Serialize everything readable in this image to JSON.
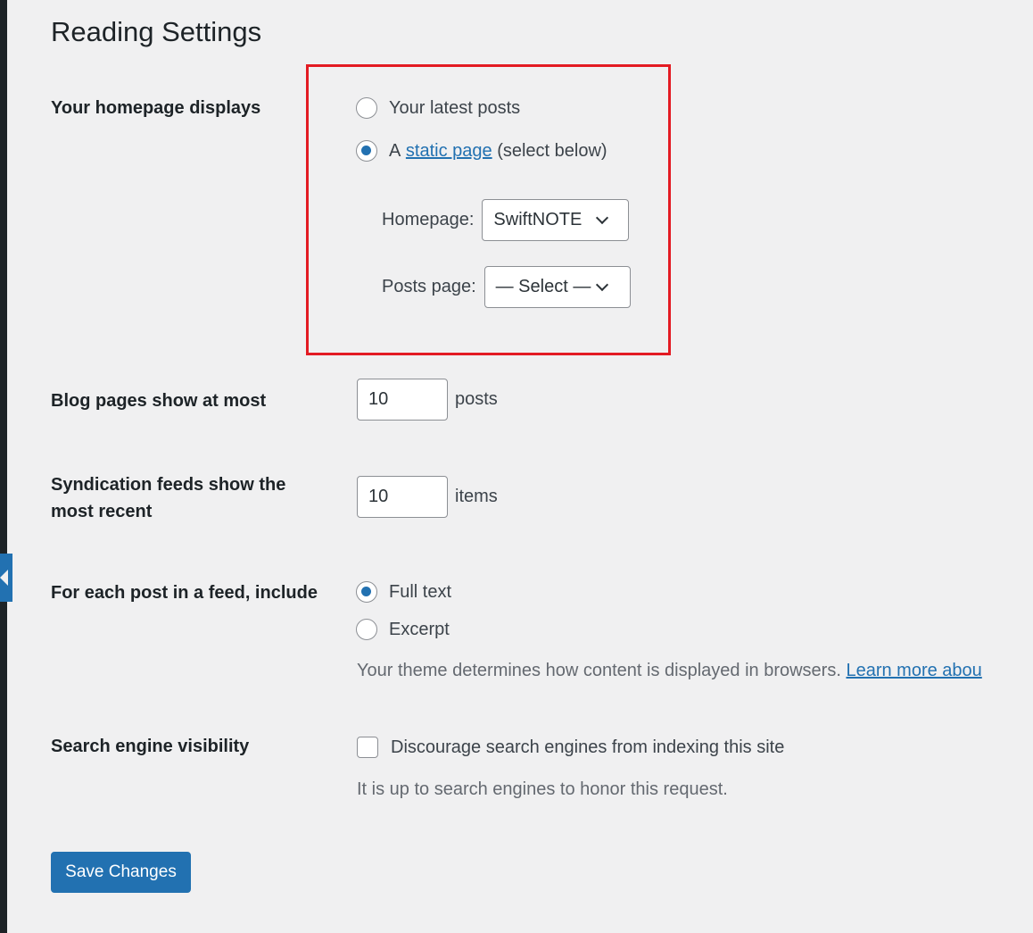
{
  "page": {
    "title": "Reading Settings"
  },
  "homepage_displays": {
    "label": "Your homepage displays",
    "option_latest": "Your latest posts",
    "option_static_prefix": "A",
    "option_static_link": "static page",
    "option_static_suffix": "(select below)",
    "selected": "static page",
    "homepage_label": "Homepage:",
    "homepage_value": "SwiftNOTE",
    "posts_page_label": "Posts page:",
    "posts_page_value": "— Select —"
  },
  "blog_pages": {
    "label": "Blog pages show at most",
    "value": "10",
    "suffix": "posts"
  },
  "syndication": {
    "label_line1": "Syndication feeds show the",
    "label_line2": "most recent",
    "value": "10",
    "suffix": "items"
  },
  "feed_include": {
    "label": "For each post in a feed, include",
    "option_full": "Full text",
    "option_excerpt": "Excerpt",
    "selected": "Full text",
    "description": "Your theme determines how content is displayed in browsers.",
    "learn_more": "Learn more abou"
  },
  "search_visibility": {
    "label": "Search engine visibility",
    "checkbox_label": "Discourage search engines from indexing this site",
    "checked": false,
    "description": "It is up to search engines to honor this request."
  },
  "actions": {
    "save_label": "Save Changes"
  },
  "colors": {
    "accent": "#2271b1",
    "highlight_border": "#e31b23",
    "background": "#f0f0f1"
  }
}
